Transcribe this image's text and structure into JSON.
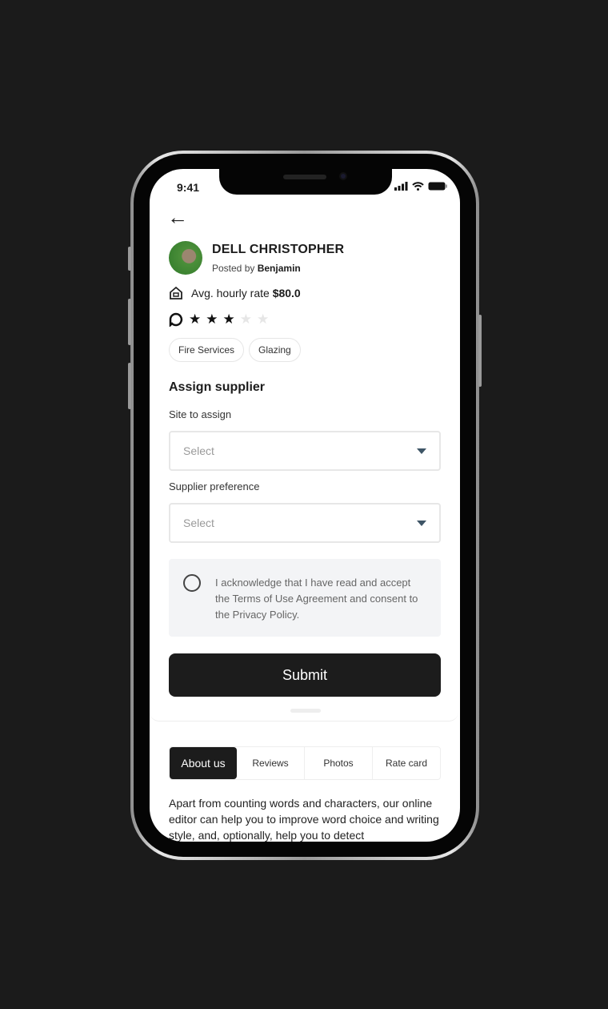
{
  "status_bar": {
    "time": "9:41"
  },
  "profile": {
    "name": "DELL CHRISTOPHER",
    "posted_by_label": "Posted by",
    "posted_by": "Benjamin",
    "rate_label": "Avg. hourly rate",
    "rate_value": "$80.0",
    "rating": 3,
    "rating_max": 5,
    "tags": [
      "Fire Services",
      "Glazing"
    ]
  },
  "form": {
    "title": "Assign supplier",
    "site_label": "Site to assign",
    "site_placeholder": "Select",
    "supplier_label": "Supplier preference",
    "supplier_placeholder": "Select",
    "ack_text": "I acknowledge that I have read and accept the Terms of Use Agreement and consent to the Privacy Policy.",
    "submit": "Submit"
  },
  "tabs": [
    {
      "label": "About us",
      "active": true
    },
    {
      "label": "Reviews"
    },
    {
      "label": "Photos"
    },
    {
      "label": "Rate card"
    }
  ],
  "about_text": "Apart from counting words and characters, our online editor can help you to improve word choice and writing style, and, optionally, help you to detect",
  "colors": {
    "primary": "#1c1c1c",
    "background": "#1b1b1b",
    "dropdown_arrow": "#3e5566"
  }
}
